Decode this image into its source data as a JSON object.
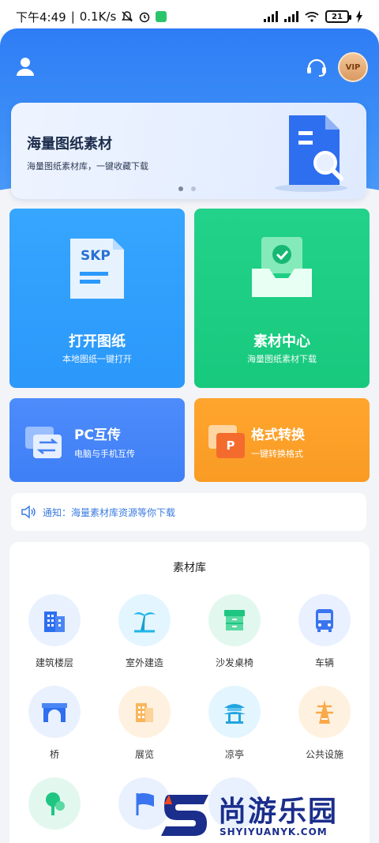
{
  "status": {
    "time": "下午4:49",
    "speed": "0.1K/s",
    "battery": "21"
  },
  "banner": {
    "title": "海量图纸素材",
    "subtitle": "海量图纸素材库，一键收藏下载"
  },
  "cards": {
    "open": {
      "title": "打开图纸",
      "subtitle": "本地图纸一键打开",
      "doc_label": "SKP"
    },
    "material": {
      "title": "素材中心",
      "subtitle": "海量图纸素材下载"
    },
    "pc": {
      "title": "PC互传",
      "subtitle": "电脑与手机互传"
    },
    "convert": {
      "title": "格式转换",
      "subtitle": "一键转换格式",
      "icon_letter": "P"
    }
  },
  "notice": {
    "text": "通知：海量素材库资源等你下载"
  },
  "vip_label": "VIP",
  "library": {
    "title": "素材库",
    "items": [
      {
        "label": "建筑楼层"
      },
      {
        "label": "室外建造"
      },
      {
        "label": "沙发桌椅"
      },
      {
        "label": "车辆"
      },
      {
        "label": "桥"
      },
      {
        "label": "展览"
      },
      {
        "label": "凉亭"
      },
      {
        "label": "公共设施"
      }
    ]
  },
  "watermark": {
    "brand": "尚游乐园",
    "url": "SHYIYUANYK.COM"
  },
  "colors": {
    "primary": "#2f7df5",
    "green": "#17c97d",
    "orange": "#f99b24",
    "blue_card": "#2b98fa"
  }
}
